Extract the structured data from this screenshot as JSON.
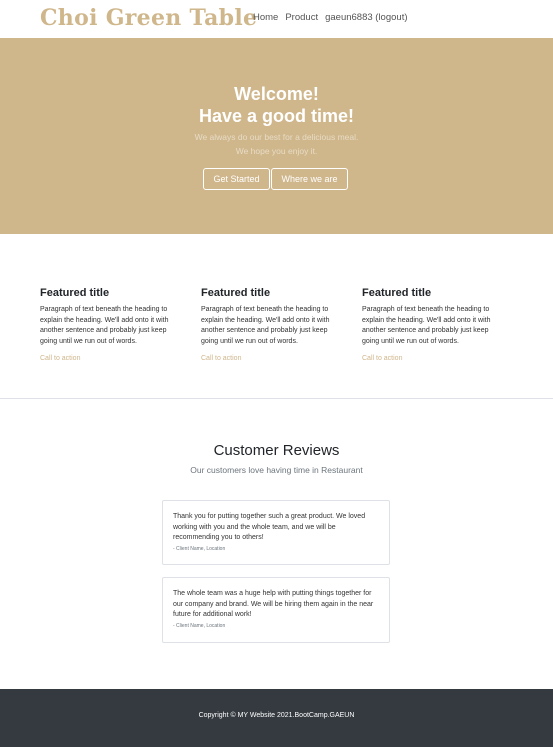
{
  "brand": "Choi Green Table",
  "nav": {
    "home": "Home",
    "product": "Product",
    "user": "gaeun6883 (logout)"
  },
  "hero": {
    "title_line1": "Welcome!",
    "title_line2": "Have a good time!",
    "sub_line1": "We always do our best for a delicious meal.",
    "sub_line2": "We hope you enjoy it.",
    "btn_start": "Get Started",
    "btn_where": "Where we are"
  },
  "features": [
    {
      "title": "Featured title",
      "text": "Paragraph of text beneath the heading to explain the heading. We'll add onto it with another sentence and probably just keep going until we run out of words.",
      "cta": "Call to action"
    },
    {
      "title": "Featured title",
      "text": "Paragraph of text beneath the heading to explain the heading. We'll add onto it with another sentence and probably just keep going until we run out of words.",
      "cta": "Call to action"
    },
    {
      "title": "Featured title",
      "text": "Paragraph of text beneath the heading to explain the heading. We'll add onto it with another sentence and probably just keep going until we run out of words.",
      "cta": "Call to action"
    }
  ],
  "reviews": {
    "title": "Customer Reviews",
    "subtitle": "Our customers love having time in Restaurant",
    "items": [
      {
        "text": "Thank you for putting together such a great product. We loved working with you and the whole team, and we will be recommending you to others!",
        "who": "- Client Name, Location"
      },
      {
        "text": "The whole team was a huge help with putting things together for our company and brand. We will be hiring them again in the near future for additional work!",
        "who": "- Client Name, Location"
      }
    ]
  },
  "footer": {
    "text": "Copyright © MY Website 2021.BootCamp.GAEUN"
  },
  "colors": {
    "accent": "#cfb68b",
    "footer_bg": "#343a40"
  }
}
